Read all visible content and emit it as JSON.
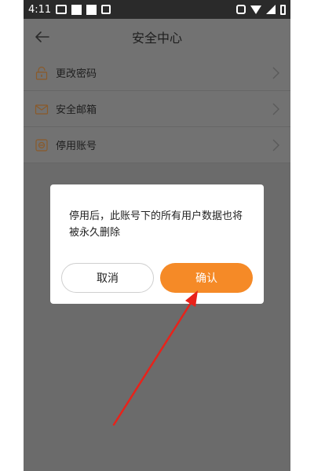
{
  "status_bar": {
    "time": "4:11"
  },
  "header": {
    "title": "安全中心"
  },
  "settings": {
    "items": [
      {
        "label": "更改密码",
        "icon": "lock-icon"
      },
      {
        "label": "安全邮箱",
        "icon": "mail-icon"
      },
      {
        "label": "停用账号",
        "icon": "deactivate-icon"
      }
    ]
  },
  "dialog": {
    "message": "停用后，此账号下的所有用户数据也将被永久删除",
    "cancel_label": "取消",
    "confirm_label": "确认"
  },
  "colors": {
    "accent": "#f58a27",
    "annotation": "#e8221a",
    "overlay": "#6b6b6b"
  }
}
